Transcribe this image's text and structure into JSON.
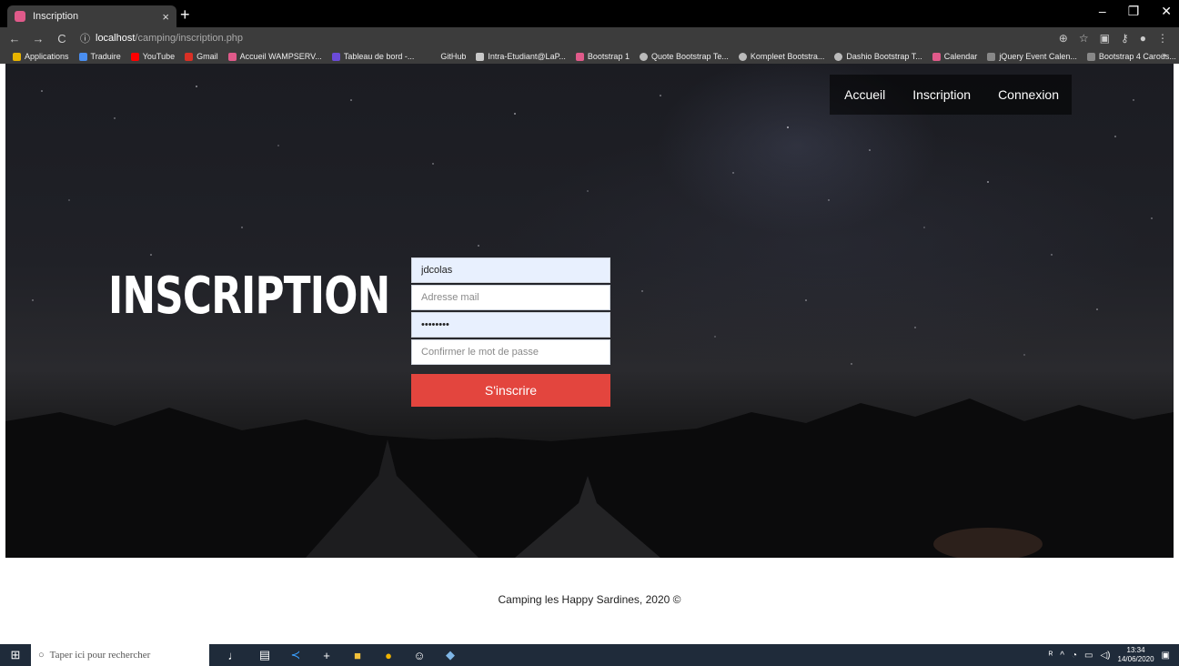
{
  "browser": {
    "tab_title": "Inscription",
    "tab_close": "×",
    "new_tab": "+",
    "url_host": "localhost",
    "url_path": "/camping/inscription.php",
    "window_controls": [
      "–",
      "❐",
      "✕"
    ],
    "bookmarks": [
      {
        "label": "Applications",
        "color": "#e8b400"
      },
      {
        "label": "Traduire",
        "color": "#4a8ef0"
      },
      {
        "label": "YouTube",
        "color": "#ff0000"
      },
      {
        "label": "Gmail",
        "color": "#d93025"
      },
      {
        "label": "Accueil WAMPSERV...",
        "color": "#e05a8a"
      },
      {
        "label": "Tableau de bord -...",
        "color": "#6b4bd8"
      },
      {
        "label": "GitHub",
        "color": "#3c3c3c"
      },
      {
        "label": "Intra-Etudiant@LaP...",
        "color": "#c8c8c8"
      },
      {
        "label": "Bootstrap 1",
        "color": "#e05a8a"
      },
      {
        "label": "Quote Bootstrap Te...",
        "color": "#bbbbbb"
      },
      {
        "label": "Kompleet Bootstra...",
        "color": "#bbbbbb"
      },
      {
        "label": "Dashio Bootstrap T...",
        "color": "#bbbbbb"
      },
      {
        "label": "Calendar",
        "color": "#e05a8a"
      },
      {
        "label": "jQuery Event Calen...",
        "color": "#888888"
      },
      {
        "label": "Bootstrap 4 Carous...",
        "color": "#888888"
      }
    ],
    "bookmarks_more": "»"
  },
  "nav": {
    "items": [
      "Accueil",
      "Inscription",
      "Connexion"
    ]
  },
  "hero": {
    "title": "INSCRIPTION"
  },
  "form": {
    "login_value": "jdcolas",
    "email_placeholder": "Adresse mail",
    "password_value": "jdcolas1",
    "confirm_placeholder": "Confirmer le mot de passe",
    "submit_label": "S'inscrire"
  },
  "footer": {
    "text": "Camping les Happy Sardines, 2020 ©"
  },
  "taskbar": {
    "search_placeholder": "Taper ici pour rechercher",
    "time": "13:34",
    "date": "14/06/2020"
  },
  "colors": {
    "accent": "#e3453e",
    "taskbar": "#1f2b3a"
  }
}
